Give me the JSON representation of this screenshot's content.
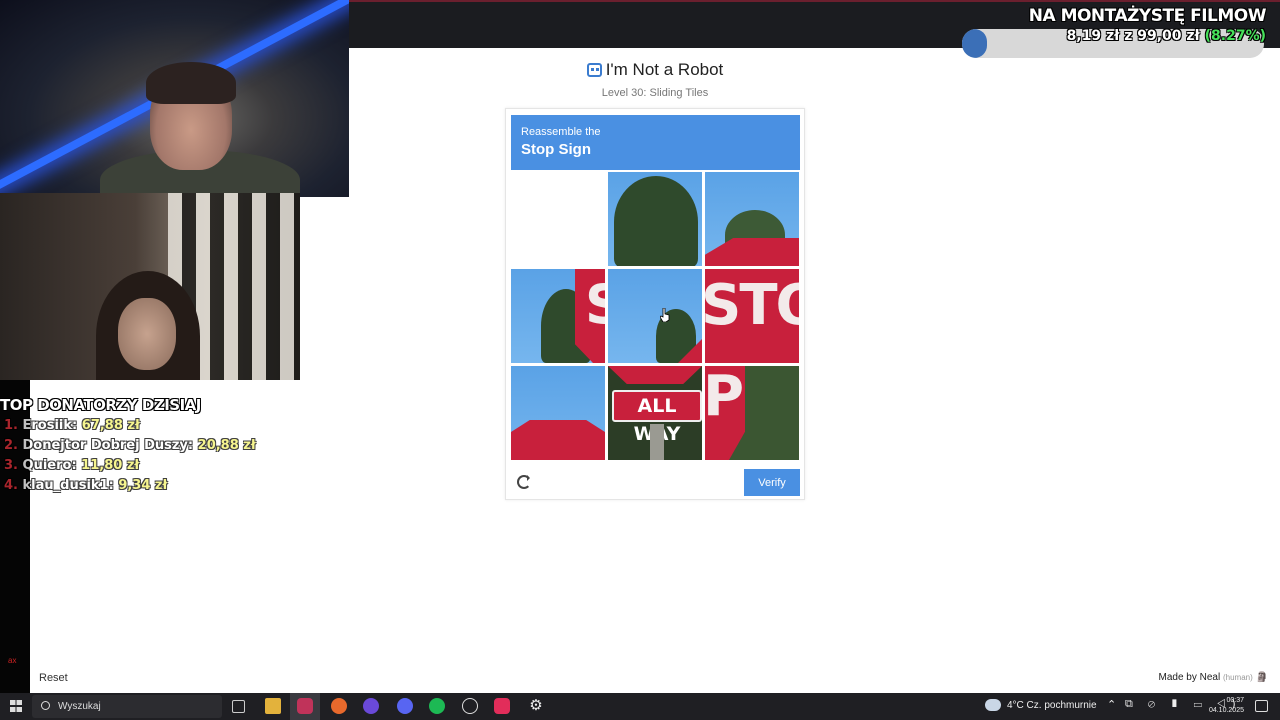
{
  "donors": {
    "title": "TOP DONATORZY DZISIAJ",
    "items": [
      {
        "num": "1.",
        "name": "Erosiik",
        "amount": "67,88 zł"
      },
      {
        "num": "2.",
        "name": "Donejtor Dobrej Duszy",
        "amount": "20,88 zł"
      },
      {
        "num": "3.",
        "name": "Quiero",
        "amount": "11,80 zł"
      },
      {
        "num": "4.",
        "name": "klau_dusik1",
        "amount": "9,34 zł"
      }
    ]
  },
  "left_small": "ax",
  "reset_label": "Reset",
  "goal": {
    "title": "NA MONTAŻYSTĘ FILMOW",
    "current": "8,19 zł",
    "sep": "z",
    "target": "99,00 zł",
    "percent": "(8.27%)",
    "progress_fraction": 0.0827
  },
  "captcha": {
    "title": "I'm Not a Robot",
    "subtitle": "Level 30: Sliding Tiles",
    "instruction_small": "Reassemble the",
    "instruction_big": "Stop Sign",
    "verify_label": "Verify",
    "tile_texts": {
      "sto": "STO",
      "s": "S",
      "p": "P",
      "allway": "ALL WAY"
    }
  },
  "made_by": {
    "text": "Made by Neal",
    "tag": "(human)"
  },
  "taskbar": {
    "search_placeholder": "Wyszukaj",
    "weather": "4°C  Cz. pochmurnie",
    "time": "00:37",
    "date": "04.10.2025"
  },
  "colors": {
    "accent": "#4a90e2",
    "stop_red": "#c8203c",
    "goal_green": "#46e05a",
    "donor_amount": "#f4f26a"
  }
}
